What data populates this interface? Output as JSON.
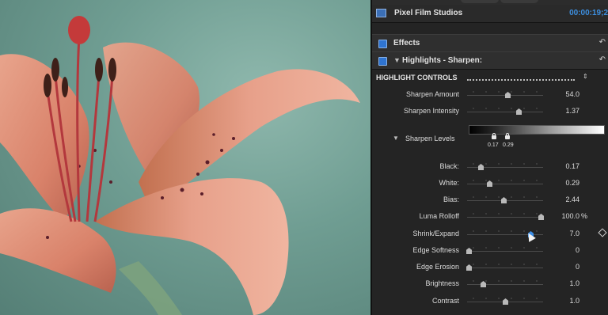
{
  "panel": {
    "title": "Pixel Film Studios",
    "timecode": "00:00:19;2",
    "title_icon": "film-strip-icon"
  },
  "sections": {
    "effects": {
      "label": "Effects",
      "enabled": true
    },
    "highlights": {
      "label": "Highlights - Sharpen:",
      "enabled": true
    }
  },
  "highlight_controls": {
    "label": "HIGHLIGHT CONTROLS"
  },
  "sliders_top": [
    {
      "label": "Sharpen Amount",
      "value": "54.0",
      "position": 0.54
    },
    {
      "label": "Sharpen Intensity",
      "value": "1.37",
      "position": 0.68
    }
  ],
  "sharpen_levels": {
    "label": "Sharpen Levels",
    "low_value": "0.17",
    "high_value": "0.29"
  },
  "sliders_bottom": [
    {
      "label": "Black:",
      "value": "0.17",
      "position": 0.17
    },
    {
      "label": "White:",
      "value": "0.29",
      "position": 0.29
    },
    {
      "label": "Bias:",
      "value": "2.44",
      "position": 0.48
    },
    {
      "label": "Luma Rolloff",
      "value": "100.0",
      "unit": "%",
      "position": 1.0
    },
    {
      "label": "Shrink/Expand",
      "value": "7.0",
      "position": 0.85,
      "active": true,
      "keyframe": true
    },
    {
      "label": "Edge Softness",
      "value": "0",
      "position": 0.0
    },
    {
      "label": "Edge Erosion",
      "value": "0",
      "position": 0.0
    },
    {
      "label": "Brightness",
      "value": "1.0",
      "position": 0.2
    },
    {
      "label": "Contrast",
      "value": "1.0",
      "position": 0.5
    }
  ],
  "colors": {
    "accent": "#3b8de6",
    "panel_bg": "#242424",
    "viewer_bg": "#6f9d92"
  }
}
